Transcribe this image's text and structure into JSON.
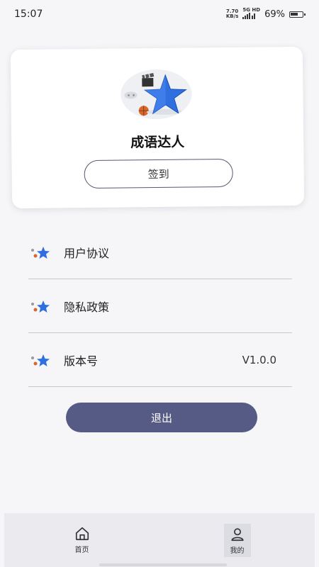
{
  "status_bar": {
    "time": "15:07",
    "net_speed_value": "7.70",
    "net_speed_unit": "KB/s",
    "net_type_top": "5G HD",
    "battery_percent": "69%",
    "battery_level": 0.69
  },
  "profile": {
    "app_name": "成语达人",
    "checkin_label": "签到"
  },
  "menu": {
    "items": [
      {
        "label": "用户协议",
        "value": ""
      },
      {
        "label": "隐私政策",
        "value": ""
      },
      {
        "label": "版本号",
        "value": "V1.0.0"
      }
    ]
  },
  "logout_label": "退出",
  "tab_bar": {
    "tabs": [
      {
        "label": "首页",
        "icon": "home-icon"
      },
      {
        "label": "我的",
        "icon": "user-icon"
      }
    ]
  },
  "colors": {
    "accent": "#555b84",
    "star": "#2f6fe0"
  }
}
